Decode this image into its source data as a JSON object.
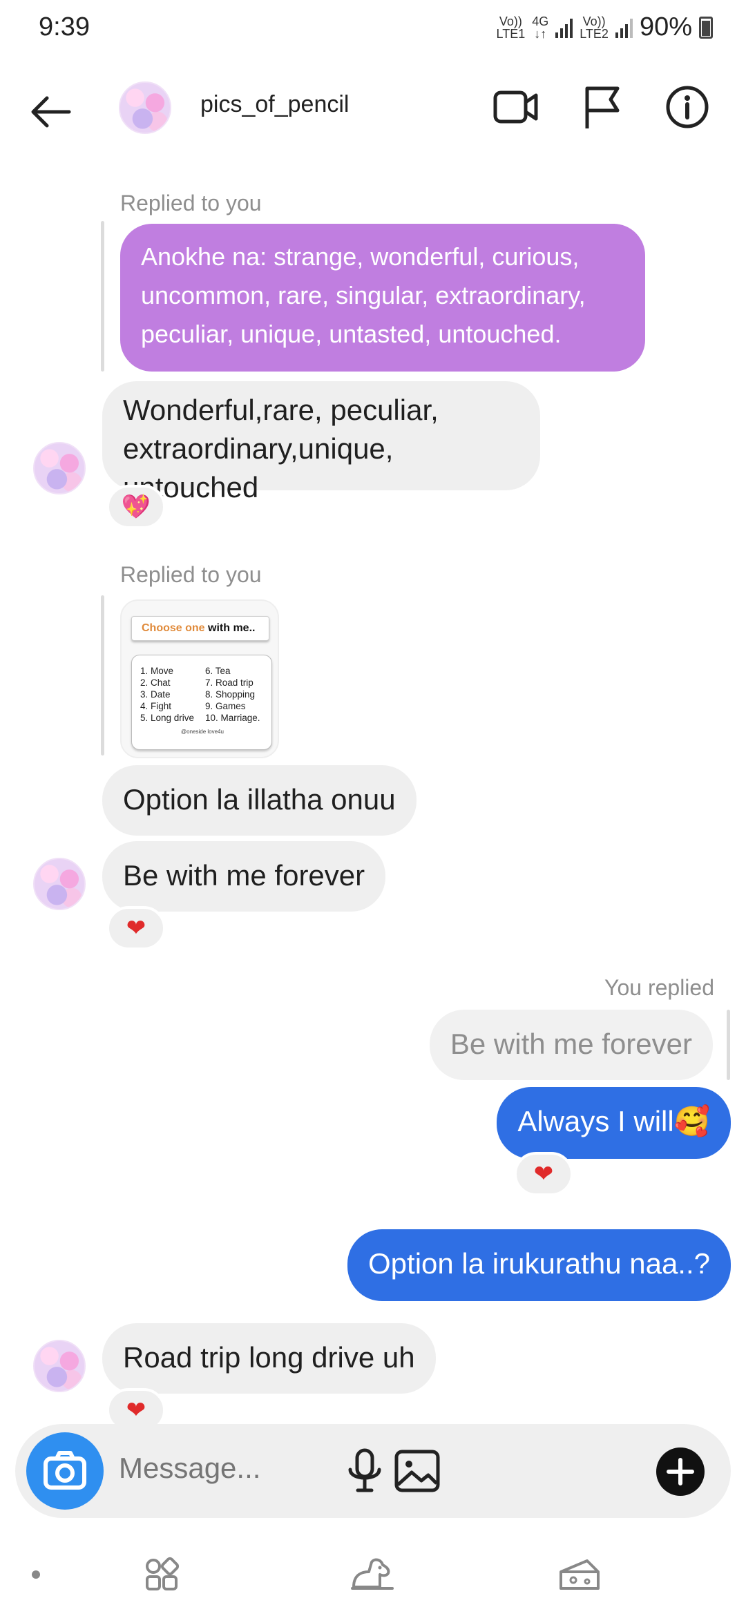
{
  "status_bar": {
    "time": "9:39",
    "sim1_top": "Vo))",
    "sim1_bottom": "LTE1",
    "net_top": "4G",
    "net_bottom": "↓↑",
    "sim2_top": "Vo))",
    "sim2_bottom": "LTE2",
    "battery": "90%"
  },
  "header": {
    "contact_name": "pics_of_pencil",
    "icons": [
      "back-arrow-icon",
      "video-call-icon",
      "flag-icon",
      "info-icon"
    ]
  },
  "messages": {
    "replied_label_1": "Replied to you",
    "quoted_message": "Anokhe na: strange, wonderful, curious, uncommon, rare, singular, extraordinary, peculiar, unique, untasted, untouched.",
    "reply_1": "Wonderful,rare, peculiar, extraordinary,unique, untouched",
    "reaction_1": "💖",
    "replied_label_2": "Replied to you",
    "story": {
      "title_highlight": "Choose one",
      "title_rest": " with me..",
      "col1": [
        "1. Move",
        "2. Chat",
        "3. Date",
        "4. Fight",
        "5. Long drive"
      ],
      "col2": [
        "6. Tea",
        "7. Road trip",
        "8. Shopping",
        "9. Games",
        "10. Marriage."
      ],
      "tag": "@oneside love4u"
    },
    "msg_option_illatha": "Option la illatha onuu",
    "msg_be_with_me": "Be with me forever",
    "reaction_2": "❤",
    "you_replied_label": "You replied",
    "quoted_own": "Be with me forever",
    "msg_always": "Always I will🥰",
    "reaction_3": "❤",
    "msg_option_irukurathu": "Option la irukurathu naa..?",
    "msg_road_trip": "Road trip long drive uh",
    "reaction_4": "❤"
  },
  "composer": {
    "placeholder": "Message...",
    "icons": [
      "camera-icon",
      "microphone-icon",
      "gallery-icon",
      "plus-icon"
    ]
  },
  "nav": {
    "icons": [
      "nav-dot-icon",
      "apps-icon",
      "dog-icon",
      "cheese-icon"
    ]
  },
  "colors": {
    "purple_bubble": "#c07ee0",
    "blue_bubble": "#2f6fe4",
    "camera_blue": "#2f8ff0",
    "grey_bubble": "#efefef"
  }
}
